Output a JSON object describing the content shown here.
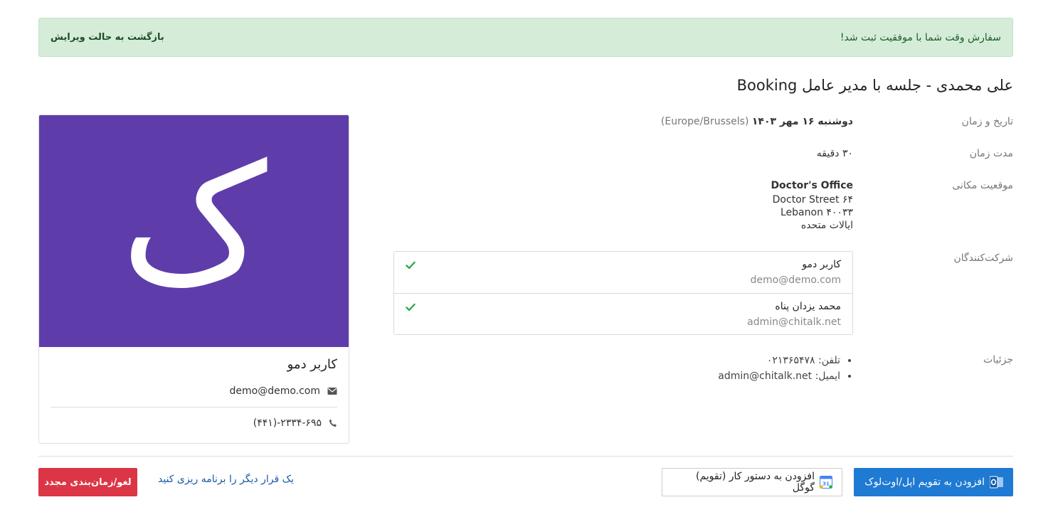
{
  "alert": {
    "message": "سفارش وقت شما با موفقیت ثبت شد!",
    "back_label": "بازگشت به حالت ویرایش",
    "bg_color": "#d5ecd9"
  },
  "booking": {
    "title": "علی محمدی - جلسه با مدیر عامل Booking",
    "fields": {
      "datetime_label": "تاریخ و زمان",
      "datetime_value": "دوشنبه ۱۶ مهر ۱۴۰۳",
      "timezone": "(Europe/Brussels)",
      "duration_label": "مدت زمان",
      "duration_value": "۳۰ دقیقه",
      "location_label": "موقعیت مکانی",
      "location_name": "Doctor's Office",
      "location_line1": "Doctor Street ۶۴",
      "location_line2": "Lebanon ۴۰۰۳۳",
      "location_line3": "ایالات متحده",
      "attendees_label": "شرکت‌کنندگان",
      "details_label": "جزئیات"
    },
    "attendees": [
      {
        "name": "کاربر دمو",
        "email": "demo@demo.com",
        "status_icon": "check-icon"
      },
      {
        "name": "محمد یزدان پناه",
        "email": "admin@chitalk.net",
        "status_icon": "check-icon"
      }
    ],
    "details": [
      {
        "text": "تلفن: ۰۲۱۳۶۵۴۷۸"
      },
      {
        "text": "ایمیل: admin@chitalk.net"
      }
    ]
  },
  "host_card": {
    "avatar_letter": "ک",
    "avatar_color": "#5e3dab",
    "name": "کاربر دمو",
    "email": "demo@demo.com",
    "phone": "(۴۴۱)-۲۳۳۴-۶۹۵",
    "email_icon": "envelope-icon",
    "phone_icon": "phone-icon"
  },
  "actions": {
    "outlook_label": "افزودن به تقویم اپل/اوت‌لوک",
    "google_label": "افزودن به دستور کار (تقویم) گوگل",
    "google_icon_text": "31",
    "rebook_label": "یک قرار دیگر را برنامه ریزی کنید",
    "cancel_label": "لغو/زمان‌بندی مجدد",
    "outlook_color": "#1e7ad2",
    "cancel_color": "#dc3545"
  }
}
